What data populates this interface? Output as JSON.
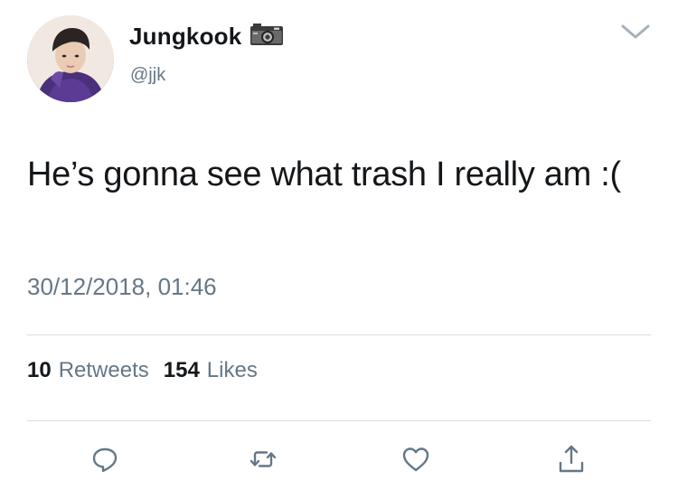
{
  "tweet": {
    "author": {
      "display_name": "Jungkook",
      "handle": "@jjk",
      "badge_icon": "camera-icon",
      "avatar_icon": "avatar"
    },
    "text": "He’s gonna see what trash I really am :(",
    "timestamp": "30/12/2018, 01:46",
    "stats": {
      "retweets_count": "10",
      "retweets_label": "Retweets",
      "likes_count": "154",
      "likes_label": "Likes"
    },
    "actions": [
      {
        "icon": "reply-icon"
      },
      {
        "icon": "retweet-icon"
      },
      {
        "icon": "heart-icon"
      },
      {
        "icon": "share-icon"
      }
    ],
    "menu_icon": "chevron-down-icon"
  },
  "colors": {
    "text_primary": "#14171a",
    "text_secondary": "#657786",
    "divider": "#d8dde2",
    "icon": "#657786"
  }
}
